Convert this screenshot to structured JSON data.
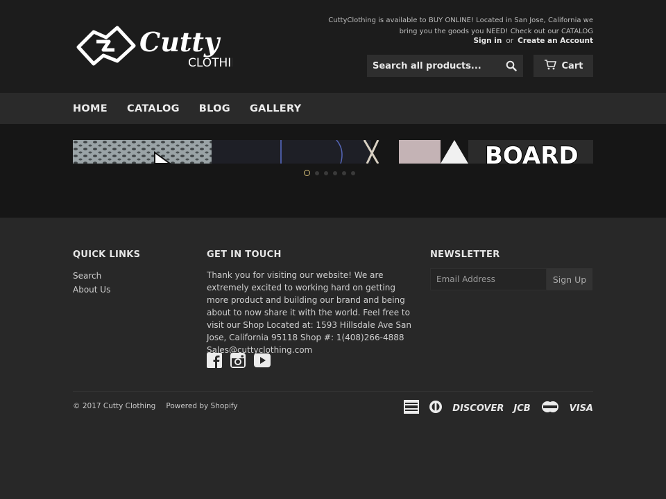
{
  "header": {
    "tagline": "CuttyClothing is available to BUY ONLINE! Located in San Jose, California we bring you the goods you NEED! Check out our CATALOG",
    "sign_in": "Sign in",
    "or": "or",
    "create_account": "Create an Account",
    "search_placeholder": "Search all products...",
    "cart_label": "Cart",
    "logo": {
      "wordmark_top": "Cutty",
      "wordmark_bottom": "CLOTHING"
    }
  },
  "nav": {
    "items": [
      "HOME",
      "CATALOG",
      "BLOG",
      "GALLERY"
    ]
  },
  "hero": {
    "slide_text": "BOARD",
    "slide_count": 6,
    "active_slide": 1
  },
  "footer": {
    "quick_links": {
      "title": "QUICK LINKS",
      "items": [
        "Search",
        "About Us"
      ]
    },
    "get_in_touch": {
      "title": "GET IN TOUCH",
      "text": "Thank you for visiting our website! We are extremely excited to working hard on getting more product and building our brand and being about to now share it with the world. Feel free to visit our Shop Located at: 1593 Hillsdale Ave San Jose, California 95118 Shop #: 1(408)266-4888 Sales@cuttyclothing.com"
    },
    "social_icons": [
      "facebook-icon",
      "instagram-icon",
      "youtube-icon"
    ],
    "newsletter": {
      "title": "NEWSLETTER",
      "placeholder": "Email Address",
      "button": "Sign Up"
    },
    "copyright": "© 2017 Cutty Clothing",
    "powered_by": "Powered by Shopify",
    "payment_methods": [
      "American Express",
      "Diners Club",
      "Discover",
      "JCB",
      "MasterCard",
      "Visa"
    ],
    "payment_labels": {
      "discover": "DISCOVER",
      "jcb": "JCB",
      "visa": "VISA",
      "mastercard": "MasterCard"
    }
  },
  "colors": {
    "header_bg": "#1c1c1c",
    "nav_bg": "#2a2a2a",
    "hero_bg": "#161616",
    "footer_bg": "#282828",
    "dot_active": "#d9c27a"
  }
}
